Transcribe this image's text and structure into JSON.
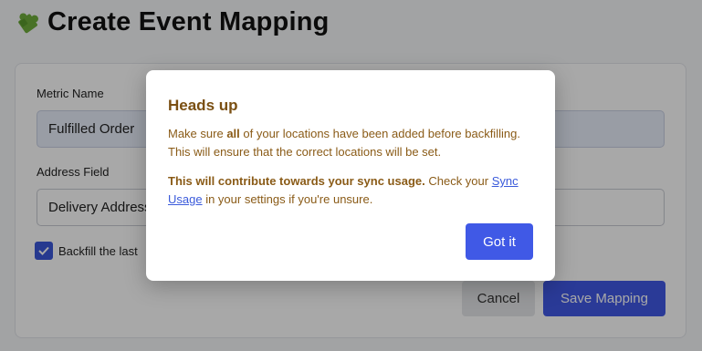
{
  "page": {
    "title": "Create Event Mapping",
    "icon": "puzzle-piece-icon"
  },
  "form": {
    "metric_label": "Metric Name",
    "metric_value": "Fulfilled Order",
    "address_label": "Address Field",
    "address_value": "Delivery Address",
    "backfill_label": "Backfill the last",
    "backfill_checked": true,
    "cancel_label": "Cancel",
    "save_label": "Save Mapping"
  },
  "modal": {
    "title": "Heads up",
    "p1_before": "Make sure ",
    "p1_bold": "all",
    "p1_after": " of your locations have been added before backfilling. This will ensure that the correct locations will be set.",
    "p2_bold": "This will contribute towards your sync usage.",
    "p2_middle": " Check your ",
    "p2_link": "Sync Usage",
    "p2_after": " in your settings if you're unsure.",
    "button_label": "Got it"
  },
  "colors": {
    "accent": "#4059e6",
    "warning_text": "#8a5b17",
    "link": "#3b5bdb"
  }
}
